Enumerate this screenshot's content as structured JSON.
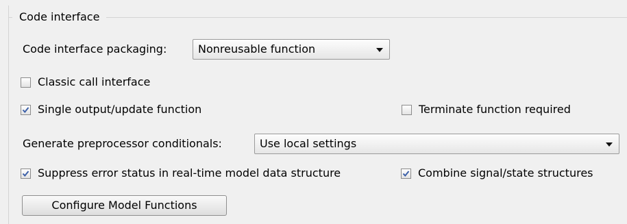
{
  "group": {
    "title": "Code interface"
  },
  "packaging": {
    "label": "Code interface packaging:",
    "value": "Nonreusable function"
  },
  "classic_call": {
    "label": "Classic call interface",
    "checked": false
  },
  "single_output": {
    "label": "Single output/update function",
    "checked": true
  },
  "terminate": {
    "label": "Terminate function required",
    "checked": false
  },
  "preprocessor": {
    "label": "Generate preprocessor conditionals:",
    "value": "Use local settings"
  },
  "suppress_error": {
    "label": "Suppress error status in real-time model data structure",
    "checked": true
  },
  "combine_structures": {
    "label": "Combine signal/state structures",
    "checked": true
  },
  "configure_button": {
    "label": "Configure Model Functions"
  },
  "colors": {
    "check_mark": "#3b5fa8",
    "group_border": "#d4d4d4"
  }
}
